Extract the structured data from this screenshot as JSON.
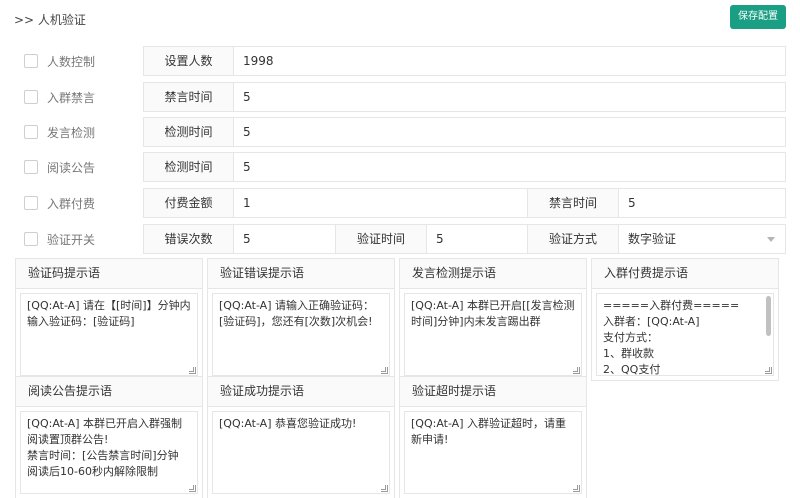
{
  "page": {
    "title": ">> 人机验证",
    "save_label": "保存配置"
  },
  "rows": [
    {
      "toggle": "人数控制",
      "label": "设置人数",
      "value": "1998"
    },
    {
      "toggle": "入群禁言",
      "label": "禁言时间",
      "value": "5"
    },
    {
      "toggle": "发言检测",
      "label": "检测时间",
      "value": "5"
    },
    {
      "toggle": "阅读公告",
      "label": "检测时间",
      "value": "5"
    }
  ],
  "pay_row": {
    "toggle": "入群付费",
    "amount_label": "付费金额",
    "amount_value": "1",
    "mute_label": "禁言时间",
    "mute_value": "5"
  },
  "verify_row": {
    "toggle": "验证开关",
    "errors_label": "错误次数",
    "errors_value": "5",
    "time_label": "验证时间",
    "time_value": "5",
    "method_label": "验证方式",
    "method_value": "数字验证"
  },
  "panels": [
    {
      "header": "验证码提示语",
      "text": "[QQ:At-A] 请在【[时间]】分钟内输入验证码：[验证码]"
    },
    {
      "header": "验证错误提示语",
      "text": "[QQ:At-A] 请输入正确验证码：[验证码]，您还有[次数]次机会!"
    },
    {
      "header": "发言检测提示语",
      "text": "[QQ:At-A] 本群已开启[[发言检测时间]分钟]内未发言踢出群"
    },
    {
      "header": "入群付费提示语",
      "text": "=====入群付费=====\n入群者：[QQ:At-A]\n支付方式：\n1、群收款\n2、QQ支付"
    },
    {
      "header": "阅读公告提示语",
      "text": "[QQ:At-A] 本群已开启入群强制阅读置顶群公告!\n禁言时间：[公告禁言时间]分钟\n阅读后10-60秒内解除限制"
    },
    {
      "header": "验证成功提示语",
      "text": "[QQ:At-A] 恭喜您验证成功!"
    },
    {
      "header": "验证超时提示语",
      "text": "[QQ:At-A] 入群验证超时，请重新申请!"
    }
  ]
}
